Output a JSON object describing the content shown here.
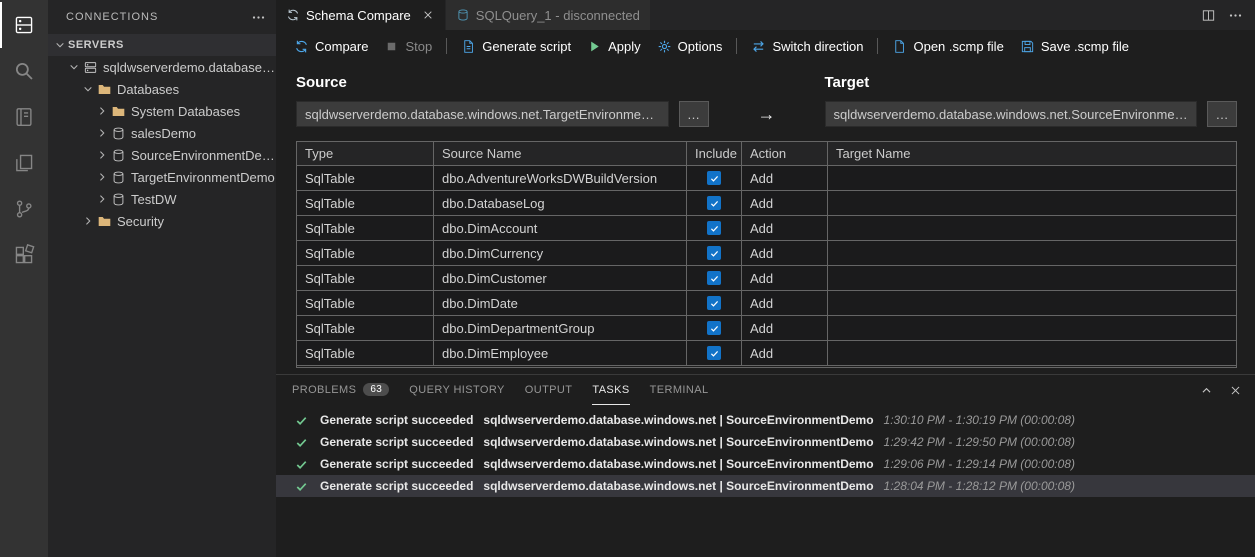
{
  "colors": {
    "accent": "#4da6e8",
    "checkbox": "#1273c8",
    "success": "#73c991",
    "folder": "#dcb67a",
    "selection": "#37373d"
  },
  "activity_bar": {
    "items": [
      {
        "name": "connections",
        "active": true
      },
      {
        "name": "search"
      },
      {
        "name": "notebooks"
      },
      {
        "name": "explorer"
      },
      {
        "name": "source-control"
      },
      {
        "name": "extensions"
      }
    ]
  },
  "sidebar": {
    "title": "CONNECTIONS",
    "section": {
      "label": "SERVERS",
      "twisty": "expanded"
    },
    "tree": [
      {
        "label": "sqldwserverdemo.database.wi...",
        "indent": 1,
        "twisty": "expanded",
        "icon": "server"
      },
      {
        "label": "Databases",
        "indent": 2,
        "twisty": "expanded",
        "icon": "folder"
      },
      {
        "label": "System Databases",
        "indent": 3,
        "twisty": "collapsed",
        "icon": "folder"
      },
      {
        "label": "salesDemo",
        "indent": 3,
        "twisty": "collapsed",
        "icon": "database"
      },
      {
        "label": "SourceEnvironmentDemo",
        "indent": 3,
        "twisty": "collapsed",
        "icon": "database"
      },
      {
        "label": "TargetEnvironmentDemo",
        "indent": 3,
        "twisty": "collapsed",
        "icon": "database"
      },
      {
        "label": "TestDW",
        "indent": 3,
        "twisty": "collapsed",
        "icon": "database"
      },
      {
        "label": "Security",
        "indent": 2,
        "twisty": "collapsed",
        "icon": "folder"
      }
    ]
  },
  "editor_tabs": [
    {
      "label": "Schema Compare",
      "icon": "compare",
      "active": true
    },
    {
      "label": "SQLQuery_1 - disconnected",
      "icon": "sql-file",
      "active": false
    }
  ],
  "toolbar": {
    "items": [
      {
        "label": "Compare",
        "icon": "compare"
      },
      {
        "label": "Stop",
        "icon": "stop",
        "enabled": false
      },
      {
        "label": "Generate script",
        "icon": "generate-script",
        "separator_before": true
      },
      {
        "label": "Apply",
        "icon": "apply"
      },
      {
        "label": "Options",
        "icon": "options"
      },
      {
        "label": "Switch direction",
        "icon": "switch-direction",
        "separator_before": true
      },
      {
        "label": "Open .scmp file",
        "icon": "open-file",
        "separator_before": true
      },
      {
        "label": "Save .scmp file",
        "icon": "save"
      }
    ]
  },
  "compare": {
    "source_label": "Source",
    "target_label": "Target",
    "source_value": "sqldwserverdemo.database.windows.net.TargetEnvironmentDe...",
    "target_value": "sqldwserverdemo.database.windows.net.SourceEnvironmentDe...",
    "browse_label": "…",
    "arrow": "→"
  },
  "compare_table": {
    "headers": [
      "Type",
      "Source Name",
      "Include",
      "Action",
      "Target Name"
    ],
    "rows": [
      {
        "type": "SqlTable",
        "source_name": "dbo.AdventureWorksDWBuildVersion",
        "include": true,
        "action": "Add",
        "target_name": ""
      },
      {
        "type": "SqlTable",
        "source_name": "dbo.DatabaseLog",
        "include": true,
        "action": "Add",
        "target_name": ""
      },
      {
        "type": "SqlTable",
        "source_name": "dbo.DimAccount",
        "include": true,
        "action": "Add",
        "target_name": ""
      },
      {
        "type": "SqlTable",
        "source_name": "dbo.DimCurrency",
        "include": true,
        "action": "Add",
        "target_name": ""
      },
      {
        "type": "SqlTable",
        "source_name": "dbo.DimCustomer",
        "include": true,
        "action": "Add",
        "target_name": ""
      },
      {
        "type": "SqlTable",
        "source_name": "dbo.DimDate",
        "include": true,
        "action": "Add",
        "target_name": ""
      },
      {
        "type": "SqlTable",
        "source_name": "dbo.DimDepartmentGroup",
        "include": true,
        "action": "Add",
        "target_name": ""
      },
      {
        "type": "SqlTable",
        "source_name": "dbo.DimEmployee",
        "include": true,
        "action": "Add",
        "target_name": ""
      }
    ]
  },
  "panel": {
    "tabs": [
      {
        "label": "PROBLEMS",
        "badge": "63"
      },
      {
        "label": "QUERY HISTORY"
      },
      {
        "label": "OUTPUT"
      },
      {
        "label": "TASKS",
        "active": true
      },
      {
        "label": "TERMINAL"
      }
    ],
    "tasks": [
      {
        "title": "Generate script succeeded",
        "detail": "sqldwserverdemo.database.windows.net | SourceEnvironmentDemo",
        "time": "1:30:10 PM - 1:30:19 PM (00:00:08)"
      },
      {
        "title": "Generate script succeeded",
        "detail": "sqldwserverdemo.database.windows.net | SourceEnvironmentDemo",
        "time": "1:29:42 PM - 1:29:50 PM (00:00:08)"
      },
      {
        "title": "Generate script succeeded",
        "detail": "sqldwserverdemo.database.windows.net | SourceEnvironmentDemo",
        "time": "1:29:06 PM - 1:29:14 PM (00:00:08)"
      },
      {
        "title": "Generate script succeeded",
        "detail": "sqldwserverdemo.database.windows.net | SourceEnvironmentDemo",
        "time": "1:28:04 PM - 1:28:12 PM (00:00:08)",
        "selected": true
      }
    ]
  }
}
